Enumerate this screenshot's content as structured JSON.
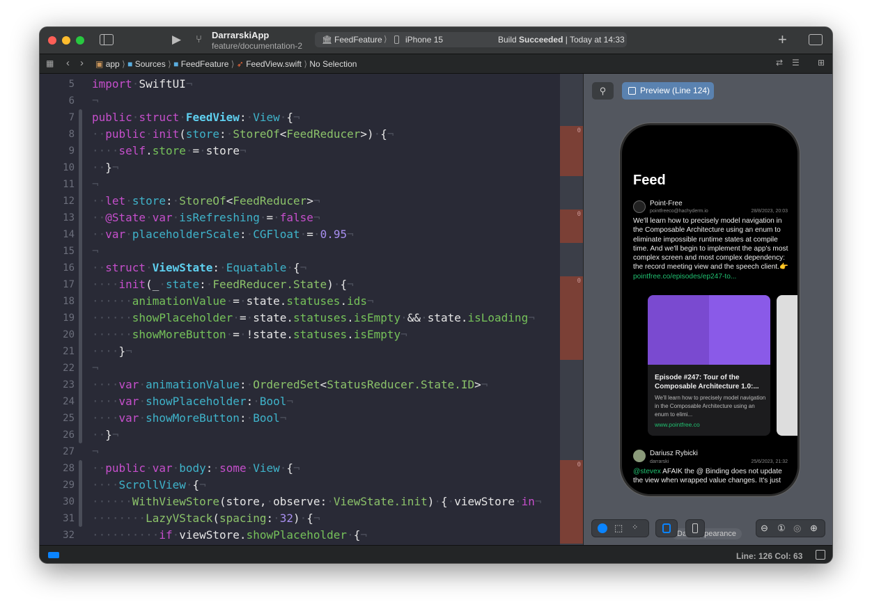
{
  "toolbar": {
    "project": "DarrarskiApp",
    "branch": "feature/documentation-2",
    "scheme": "FeedFeature",
    "device": "iPhone 15",
    "build_status_prefix": "Build",
    "build_status_bold": "Succeeded",
    "build_status_time": "| Today at 14:33"
  },
  "breadcrumb": [
    "app",
    "Sources",
    "FeedFeature",
    "FeedView.swift",
    "No Selection"
  ],
  "editor": {
    "lines": [
      {
        "n": 5,
        "i": 0,
        "t": [
          [
            "import",
            "k"
          ],
          [
            " ",
            "ws"
          ],
          [
            "SwiftUI",
            "p"
          ]
        ]
      },
      {
        "n": 6,
        "i": 0,
        "t": []
      },
      {
        "n": 7,
        "i": 0,
        "t": [
          [
            "public",
            "k"
          ],
          [
            " ",
            "ws"
          ],
          [
            "struct",
            "k"
          ],
          [
            " ",
            "ws"
          ],
          [
            "FeedView",
            "d"
          ],
          [
            ":",
            "p"
          ],
          [
            " ",
            "ws"
          ],
          [
            "View",
            "c"
          ],
          [
            " ",
            "ws"
          ],
          [
            "{",
            "p"
          ]
        ]
      },
      {
        "n": 8,
        "i": 2,
        "t": [
          [
            "public",
            "k"
          ],
          [
            " ",
            "ws"
          ],
          [
            "init",
            "k"
          ],
          [
            "(",
            "p"
          ],
          [
            "store",
            "c"
          ],
          [
            ":",
            "p"
          ],
          [
            " ",
            "ws"
          ],
          [
            "StoreOf",
            "t"
          ],
          [
            "<",
            "p"
          ],
          [
            "FeedReducer",
            "t"
          ],
          [
            ">) {",
            "p"
          ]
        ]
      },
      {
        "n": 9,
        "i": 4,
        "t": [
          [
            "self",
            "k"
          ],
          [
            ".",
            "p"
          ],
          [
            "store",
            "g"
          ],
          [
            " = ",
            "p"
          ],
          [
            "store",
            "p"
          ]
        ]
      },
      {
        "n": 10,
        "i": 2,
        "t": [
          [
            "}",
            "p"
          ]
        ]
      },
      {
        "n": 11,
        "i": 0,
        "t": []
      },
      {
        "n": 12,
        "i": 2,
        "t": [
          [
            "let",
            "k"
          ],
          [
            " ",
            "ws"
          ],
          [
            "store",
            "c"
          ],
          [
            ":",
            "p"
          ],
          [
            " ",
            "ws"
          ],
          [
            "StoreOf",
            "t"
          ],
          [
            "<",
            "p"
          ],
          [
            "FeedReducer",
            "t"
          ],
          [
            ">",
            "p"
          ]
        ]
      },
      {
        "n": 13,
        "i": 2,
        "t": [
          [
            "@State",
            "k"
          ],
          [
            " ",
            "ws"
          ],
          [
            "var",
            "k"
          ],
          [
            " ",
            "ws"
          ],
          [
            "isRefreshing",
            "c"
          ],
          [
            " = ",
            "p"
          ],
          [
            "false",
            "k"
          ]
        ]
      },
      {
        "n": 14,
        "i": 2,
        "t": [
          [
            "var",
            "k"
          ],
          [
            " ",
            "ws"
          ],
          [
            "placeholderScale",
            "c"
          ],
          [
            ":",
            "p"
          ],
          [
            " ",
            "ws"
          ],
          [
            "CGFloat",
            "c"
          ],
          [
            " = ",
            "p"
          ],
          [
            "0.95",
            "n"
          ]
        ]
      },
      {
        "n": 15,
        "i": 0,
        "t": []
      },
      {
        "n": 16,
        "i": 2,
        "t": [
          [
            "struct",
            "k"
          ],
          [
            " ",
            "ws"
          ],
          [
            "ViewState",
            "d"
          ],
          [
            ":",
            "p"
          ],
          [
            " ",
            "ws"
          ],
          [
            "Equatable",
            "c"
          ],
          [
            " ",
            "ws"
          ],
          [
            "{",
            "p"
          ]
        ]
      },
      {
        "n": 17,
        "i": 4,
        "t": [
          [
            "init",
            "k"
          ],
          [
            "(_ ",
            "p"
          ],
          [
            "state",
            "c"
          ],
          [
            ":",
            "p"
          ],
          [
            " ",
            "ws"
          ],
          [
            "FeedReducer.State",
            "t"
          ],
          [
            ") {",
            "p"
          ]
        ]
      },
      {
        "n": 18,
        "i": 6,
        "t": [
          [
            "animationValue",
            "g"
          ],
          [
            " = ",
            "p"
          ],
          [
            "state.",
            "p"
          ],
          [
            "statuses",
            "g"
          ],
          [
            ".",
            "p"
          ],
          [
            "ids",
            "g"
          ]
        ]
      },
      {
        "n": 19,
        "i": 6,
        "t": [
          [
            "showPlaceholder",
            "g"
          ],
          [
            " = ",
            "p"
          ],
          [
            "state.",
            "p"
          ],
          [
            "statuses",
            "g"
          ],
          [
            ".",
            "p"
          ],
          [
            "isEmpty",
            "g"
          ],
          [
            " && ",
            "p"
          ],
          [
            "state.",
            "p"
          ],
          [
            "isLoading",
            "g"
          ]
        ]
      },
      {
        "n": 20,
        "i": 6,
        "t": [
          [
            "showMoreButton",
            "g"
          ],
          [
            " = !",
            "p"
          ],
          [
            "state.",
            "p"
          ],
          [
            "statuses",
            "g"
          ],
          [
            ".",
            "p"
          ],
          [
            "isEmpty",
            "g"
          ]
        ]
      },
      {
        "n": 21,
        "i": 4,
        "t": [
          [
            "}",
            "p"
          ]
        ]
      },
      {
        "n": 22,
        "i": 0,
        "t": []
      },
      {
        "n": 23,
        "i": 4,
        "t": [
          [
            "var",
            "k"
          ],
          [
            " ",
            "ws"
          ],
          [
            "animationValue",
            "c"
          ],
          [
            ":",
            "p"
          ],
          [
            " ",
            "ws"
          ],
          [
            "OrderedSet",
            "t"
          ],
          [
            "<",
            "p"
          ],
          [
            "StatusReducer.State.ID",
            "t"
          ],
          [
            ">",
            "p"
          ]
        ]
      },
      {
        "n": 24,
        "i": 4,
        "t": [
          [
            "var",
            "k"
          ],
          [
            " ",
            "ws"
          ],
          [
            "showPlaceholder",
            "c"
          ],
          [
            ":",
            "p"
          ],
          [
            " ",
            "ws"
          ],
          [
            "Bool",
            "c"
          ]
        ]
      },
      {
        "n": 25,
        "i": 4,
        "t": [
          [
            "var",
            "k"
          ],
          [
            " ",
            "ws"
          ],
          [
            "showMoreButton",
            "c"
          ],
          [
            ":",
            "p"
          ],
          [
            " ",
            "ws"
          ],
          [
            "Bool",
            "c"
          ]
        ]
      },
      {
        "n": 26,
        "i": 2,
        "t": [
          [
            "}",
            "p"
          ]
        ]
      },
      {
        "n": 27,
        "i": 0,
        "t": []
      },
      {
        "n": 28,
        "i": 2,
        "t": [
          [
            "public",
            "k"
          ],
          [
            " ",
            "ws"
          ],
          [
            "var",
            "k"
          ],
          [
            " ",
            "ws"
          ],
          [
            "body",
            "c"
          ],
          [
            ":",
            "p"
          ],
          [
            " ",
            "ws"
          ],
          [
            "some",
            "k"
          ],
          [
            " ",
            "ws"
          ],
          [
            "View",
            "c"
          ],
          [
            " ",
            "ws"
          ],
          [
            "{",
            "p"
          ]
        ]
      },
      {
        "n": 29,
        "i": 4,
        "t": [
          [
            "ScrollView",
            "c"
          ],
          [
            " ",
            "ws"
          ],
          [
            "{",
            "p"
          ]
        ]
      },
      {
        "n": 30,
        "i": 6,
        "t": [
          [
            "WithViewStore",
            "t"
          ],
          [
            "(",
            "p"
          ],
          [
            "store",
            "p"
          ],
          [
            ", ",
            "p"
          ],
          [
            "observe",
            "p"
          ],
          [
            ": ",
            "p"
          ],
          [
            "ViewState.init",
            "t"
          ],
          [
            ") { ",
            "p"
          ],
          [
            "viewStore",
            "p"
          ],
          [
            " ",
            "ws"
          ],
          [
            "in",
            "k"
          ]
        ]
      },
      {
        "n": 31,
        "i": 8,
        "t": [
          [
            "LazyVStack",
            "t"
          ],
          [
            "(",
            "p"
          ],
          [
            "spacing",
            "t"
          ],
          [
            ": ",
            "p"
          ],
          [
            "32",
            "n"
          ],
          [
            ") {",
            "p"
          ]
        ]
      },
      {
        "n": 32,
        "i": 10,
        "t": [
          [
            "if",
            "k"
          ],
          [
            " ",
            "ws"
          ],
          [
            "viewStore.",
            "p"
          ],
          [
            "showPlaceholder",
            "g"
          ],
          [
            " {",
            "p"
          ]
        ]
      }
    ],
    "whitespace_glyph": "·",
    "eol_glyph": "¬"
  },
  "coverage": {
    "label": "0"
  },
  "preview": {
    "button": "Preview (Line 124)",
    "appearance": "Dark Appearance",
    "feed": {
      "title": "Feed",
      "post1": {
        "name": "Point-Free",
        "handle": "pointfreeco@hachyderm.io",
        "date": "28/8/2023, 20:03",
        "body": "We'll learn how to precisely model navigation in the Composable Architecture using an enum to eliminate impossible runtime states at compile time. And we'll begin to implement the app's most complex screen and most complex dependency: the record meeting view and the speech client.👉 ",
        "link": "pointfree.co/episodes/ep247-to...",
        "card": {
          "title": "Episode #247: Tour of the Composable Architecture 1.0:...",
          "desc": "We'll learn how to precisely model navigation in the Composable Architecture using an enum to elimi...",
          "url": "www.pointfree.co"
        }
      },
      "post2": {
        "name": "Dariusz Rybicki",
        "handle": "darrarski",
        "date": "25/6/2023, 21:32",
        "mention": "@stevex",
        "body": " AFAIK the @ Binding does not update the view when wrapped value changes. It's just"
      }
    }
  },
  "status": {
    "position": "Line: 126  Col: 63"
  },
  "colors": {
    "accent": "#0a84ff",
    "coverage_uncovered": "#7b4036",
    "link_green": "#20c070",
    "preview_button": "#5a82b0"
  }
}
